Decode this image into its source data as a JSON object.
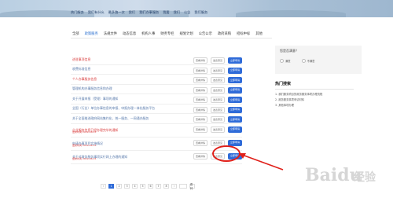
{
  "topnav": {
    "items": [
      "热门服务",
      "我们有什么",
      "最多跑一次",
      "我们",
      "我们办事服务",
      "我要",
      "我们",
      "公告",
      "我们服务"
    ]
  },
  "tabs": {
    "items": [
      "全部",
      "政策服务",
      "法规文件",
      "动态信息",
      "机构人事",
      "财务专栏",
      "规划计划",
      "公告公示",
      "政府采购",
      "招标中标",
      "其他"
    ],
    "active_index": 1
  },
  "list": {
    "view_label": "查看详情",
    "opinion_label": "发表意见",
    "apply_label": "立即申请",
    "rows": [
      {
        "title": "进驻事项信息",
        "red": true
      },
      {
        "title": "收费标准信息",
        "red": false
      },
      {
        "title": "个人办事服务信息",
        "red": true
      },
      {
        "title": "管理机构办事服务信息和办理",
        "red": false
      },
      {
        "title": "关于开展申报（受理）事项的通知",
        "red": false
      },
      {
        "title": "全国（行业）单位办事信息的申报、申报办理一体化服务平台",
        "red": false
      },
      {
        "title": "关于全面推进政府网站集约化、统一服务、一网通办服务",
        "red": false
      },
      {
        "title": "企业服务信息已经办理完毕的通知",
        "red": true,
        "sub": "更新时间 2019-06-15"
      },
      {
        "title": "申请办事项目实施情况",
        "red": false,
        "sub": "更新时间 2019-06-15"
      },
      {
        "title": "关于对政务服务事项实行网上办理的通知",
        "red": false,
        "sub": "更新时间 2019-06-15"
      }
    ]
  },
  "survey": {
    "question": "您是否满意？",
    "options": [
      "满意",
      "不满意"
    ]
  },
  "hot": {
    "heading": "热门搜索",
    "items": [
      "1. 我们服务项目的政务服务事项办理流程",
      "2. 政务服务事项申请材料",
      "3. 其他事项办理"
    ]
  },
  "pagination": {
    "pages": [
      "1",
      "2",
      "3",
      "4",
      "5",
      "6",
      "7",
      "8"
    ],
    "active": "1",
    "prev": "‹",
    "next": "›",
    "goto_label": "跳转"
  },
  "watermark": "Baidu经验"
}
